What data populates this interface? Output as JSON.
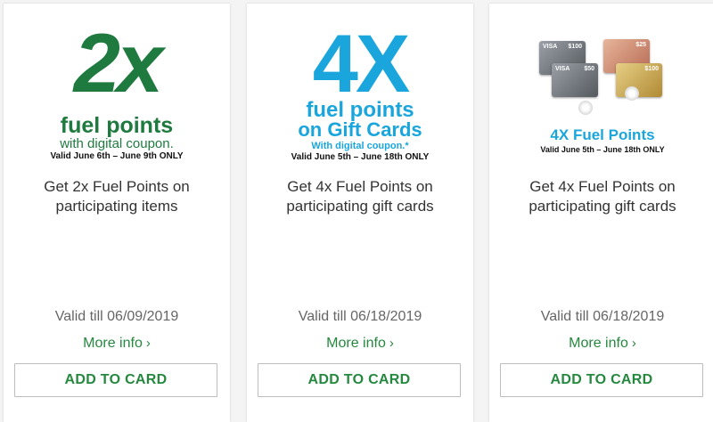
{
  "cards": [
    {
      "promo": {
        "big": "2x",
        "line1": "fuel points",
        "line2": "with digital coupon.",
        "line3": "Valid June 6th – June 9th ONLY"
      },
      "description": "Get 2x Fuel Points on participating items",
      "valid": "Valid till 06/09/2019",
      "more_info": "More info",
      "button": "ADD TO CARD"
    },
    {
      "promo": {
        "big": "4X",
        "line1": "fuel points",
        "line2": "on Gift Cards",
        "line3": "With digital coupon.*",
        "line4": "Valid June 5th – June 18th ONLY"
      },
      "description": "Get 4x Fuel Points on participating gift cards",
      "valid": "Valid till 06/18/2019",
      "more_info": "More info",
      "button": "ADD TO CARD"
    },
    {
      "promo": {
        "cards": [
          {
            "brand": "VISA",
            "value": "$100"
          },
          {
            "brand": "VISA",
            "value": "$50"
          },
          {
            "brand": "",
            "value": "$25"
          },
          {
            "brand": "",
            "value": "$100"
          }
        ],
        "line1": "4X Fuel Points",
        "line2": "Valid June 5th – June 18th ONLY"
      },
      "description": "Get 4x Fuel Points on participating gift cards",
      "valid": "Valid till 06/18/2019",
      "more_info": "More info",
      "button": "ADD TO CARD"
    }
  ],
  "colors": {
    "green": "#25883f",
    "promo_green": "#1f7a3f",
    "promo_blue": "#1aa6dc"
  },
  "icons": {
    "more_info": "chevron-right-icon"
  }
}
